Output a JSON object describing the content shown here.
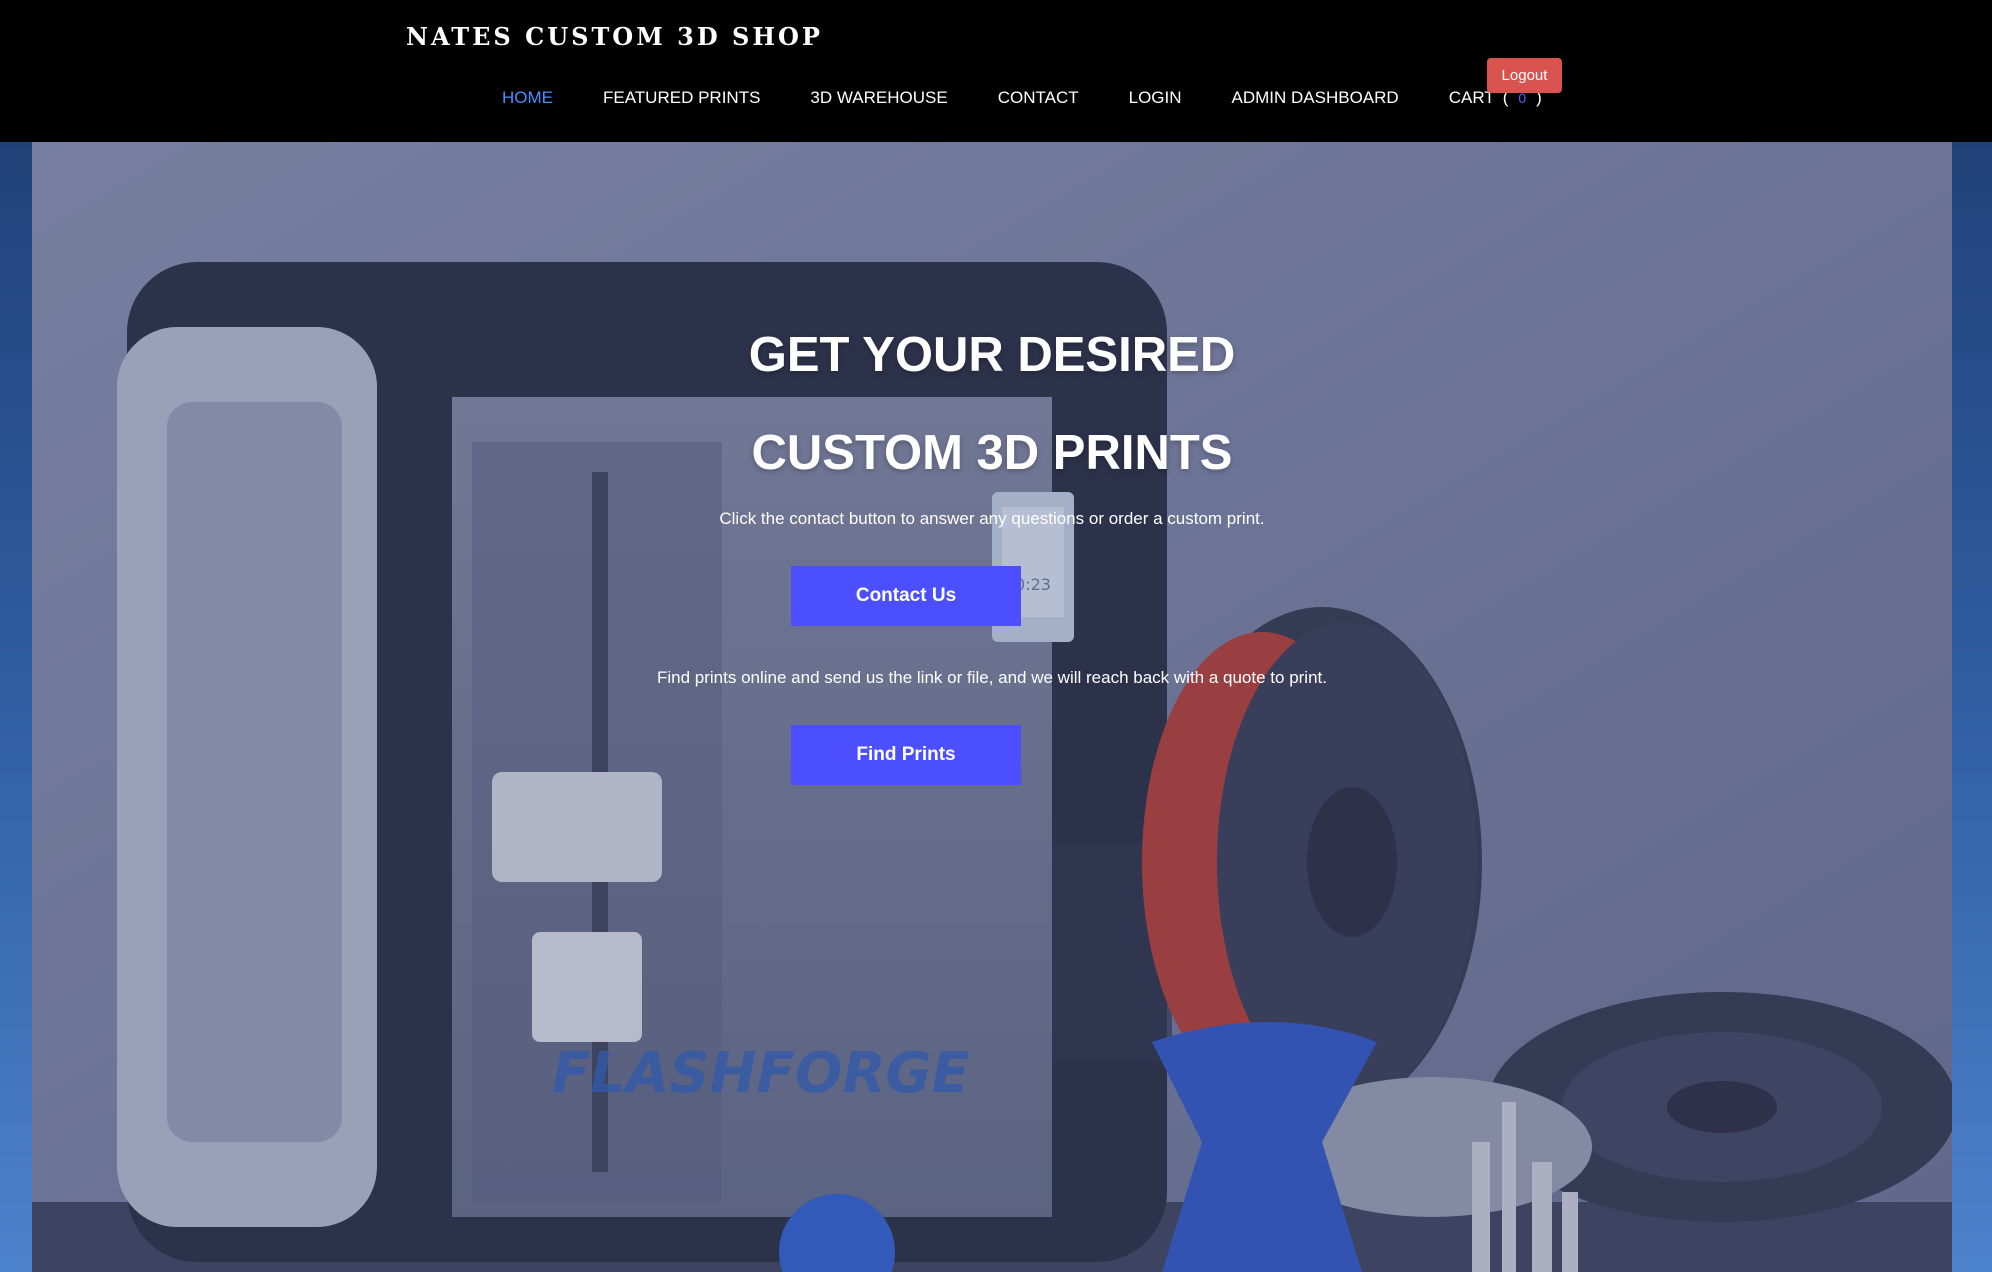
{
  "header": {
    "brand": "NATES CUSTOM 3D SHOP",
    "nav": {
      "home": "HOME",
      "featured": "FEATURED PRINTS",
      "warehouse": "3D WAREHOUSE",
      "contact": "CONTACT",
      "login": "LOGIN",
      "admin": "ADMIN DASHBOARD"
    },
    "cart": {
      "label": "CART",
      "open": "(",
      "count": "0",
      "close": ")"
    },
    "logout_label": "Logout"
  },
  "hero": {
    "headline_line1": "GET YOUR DESIRED",
    "headline_line2": "CUSTOM 3D PRINTS",
    "contact_text": "Click the contact button to answer any questions or order a custom print.",
    "contact_button": "Contact Us",
    "find_text": "Find prints online and send us the link or file, and we will reach back with a quote to print.",
    "find_button": "Find Prints",
    "printer_brand_text": "FLASHFORGE",
    "screen_text": "0:23"
  },
  "colors": {
    "accent": "#4b4fff",
    "active_nav": "#4a8fff",
    "logout": "#d9534f",
    "header_bg": "#000000"
  }
}
